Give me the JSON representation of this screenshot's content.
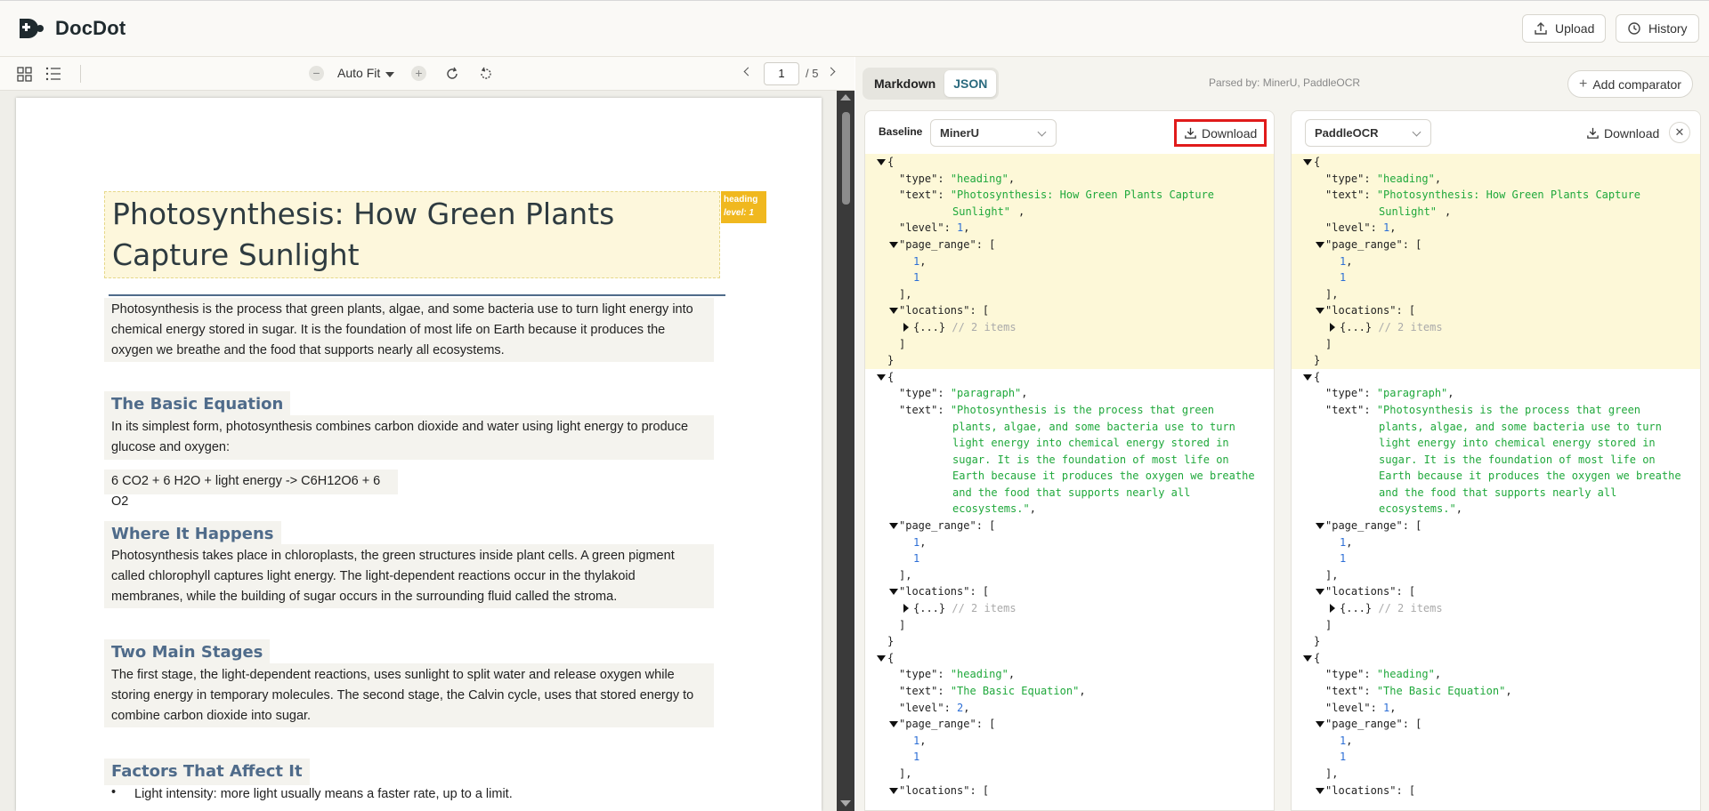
{
  "app": {
    "name": "DocDot"
  },
  "topbar": {
    "upload_label": "Upload",
    "history_label": "History"
  },
  "viewer": {
    "zoom_label": "Auto Fit",
    "page_current": "1",
    "page_total": "/ 5"
  },
  "document": {
    "title": "Photosynthesis: How Green Plants Capture Sunlight",
    "title_tag": [
      "heading",
      "level: 1"
    ],
    "intro": "Photosynthesis is the process that green plants, algae, and some bacteria use to turn light energy into chemical energy stored in sugar. It is the foundation of most life on Earth because it produces the oxygen we breathe and the food that supports nearly all ecosystems.",
    "h_basic": "The Basic Equation",
    "p_basic": "In its simplest form, photosynthesis combines carbon dioxide and water using light energy to produce glucose and oxygen:",
    "equation": "6 CO2 + 6 H2O + light energy -> C6H12O6 + 6 O2",
    "h_where": "Where It Happens",
    "p_where": "Photosynthesis takes place in chloroplasts, the green structures inside plant cells. A green pigment called chlorophyll captures light energy. The light-dependent reactions occur in the thylakoid membranes, while the building of sugar occurs in the surrounding fluid called the stroma.",
    "h_stages": "Two Main Stages",
    "p_stages": "The first stage, the light-dependent reactions, uses sunlight to split water and release oxygen while storing energy in temporary molecules. The second stage, the Calvin cycle, uses that stored energy to combine carbon dioxide into sugar.",
    "h_factors": "Factors That Affect It",
    "bullet1": "Light intensity: more light usually means a faster rate, up to a limit."
  },
  "compare": {
    "tabs": [
      "Markdown",
      "JSON"
    ],
    "parsed_by": "Parsed by: MinerU, PaddleOCR",
    "add_comparator": "Add comparator",
    "baseline_label": "Baseline",
    "left_parser": "MinerU",
    "right_parser": "PaddleOCR",
    "download_label": "Download",
    "close_symbol": "✕",
    "json": {
      "type_key": "\"type\"",
      "text_key": "\"text\"",
      "level_key": "\"level\"",
      "page_range_key": "\"page_range\"",
      "locations_key": "\"locations\"",
      "heading": "\"heading\"",
      "paragraph": "\"paragraph\"",
      "title_l1": "\"Photosynthesis: How Green Plants Capture",
      "title_l2": "Sunlight\"",
      "para_lines": [
        "\"Photosynthesis is the process that green",
        "plants, algae, and some bacteria use to turn",
        "light energy into chemical energy stored in",
        "sugar. It is the foundation of most life on",
        "Earth because it produces the oxygen we breathe",
        "and the food that supports nearly all",
        "ecosystems.\""
      ],
      "basic_eq": "\"The Basic Equation\"",
      "one": "1",
      "two": "2",
      "collapsed": "{...}",
      "items_comment": "// 2 items"
    }
  }
}
